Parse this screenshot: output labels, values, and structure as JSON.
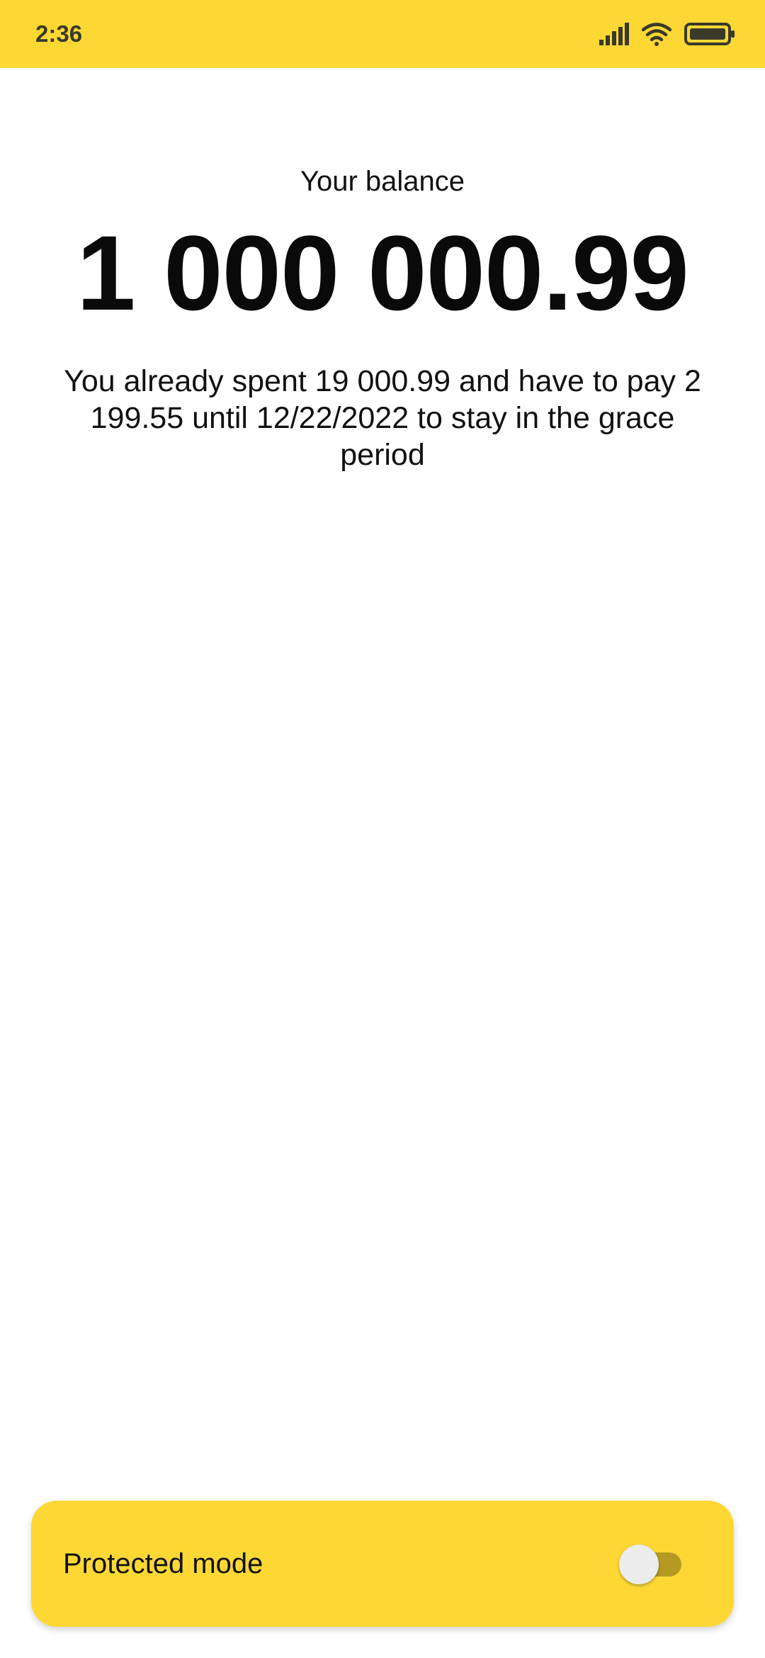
{
  "status_bar": {
    "time": "2:36",
    "icons": [
      "signal-icon",
      "wifi-icon",
      "battery-icon"
    ],
    "background_color": "#FDD835"
  },
  "balance": {
    "label": "Your balance",
    "amount": "1 000 000.99",
    "note": "You already spent 19 000.99 and have to pay 2 199.55 until 12/22/2022 to stay in the grace period"
  },
  "protected_mode": {
    "label": "Protected mode",
    "toggle_state": "off",
    "card_color": "#FDD835"
  }
}
